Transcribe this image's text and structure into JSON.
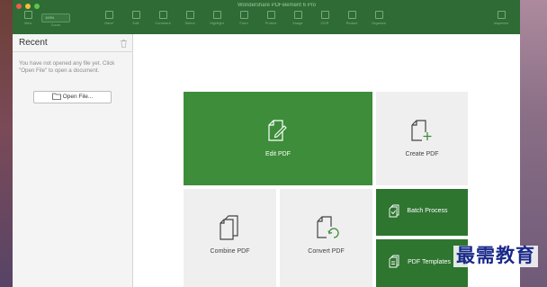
{
  "window": {
    "title": "Wondershare PDFelement 6 Pro"
  },
  "toolbar": {
    "zoom_value": "100%",
    "items": [
      {
        "label": "View"
      },
      {
        "label": "Zoom"
      },
      {
        "label": "Hand"
      },
      {
        "label": "Edit"
      },
      {
        "label": "Comment"
      },
      {
        "label": "Select"
      },
      {
        "label": "Highlight"
      },
      {
        "label": "Form"
      },
      {
        "label": "Protect"
      },
      {
        "label": "Image"
      },
      {
        "label": "OCR"
      },
      {
        "label": "Redact"
      },
      {
        "label": "Organize"
      },
      {
        "label": "Inspector"
      }
    ]
  },
  "sidebar": {
    "title": "Recent",
    "message": "You have not opened any file yet. Click \"Open File\" to open a document.",
    "open_button_label": "Open File..."
  },
  "tiles": {
    "edit_pdf": "Edit PDF",
    "create_pdf": "Create PDF",
    "combine_pdf": "Combine PDF",
    "convert_pdf": "Convert PDF",
    "batch_process": "Batch Process",
    "pdf_templates": "PDF Templates"
  },
  "watermark": "最需教育",
  "colors": {
    "toolbar": "#2f6b34",
    "accent_green": "#3d8d3a",
    "dark_green": "#2e7530",
    "tile_grey": "#f0efef"
  }
}
